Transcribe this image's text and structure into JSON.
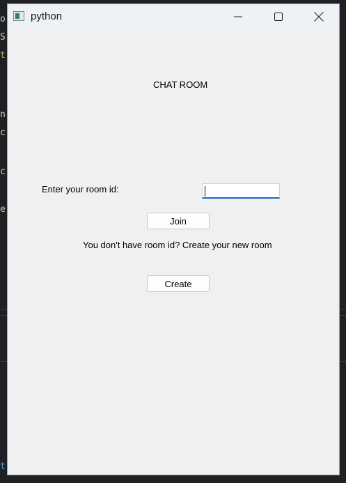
{
  "window": {
    "title": "python",
    "app_icon": "python-app-icon",
    "controls": {
      "minimize_icon": "minimize-icon",
      "maximize_icon": "maximize-icon",
      "close_icon": "close-icon"
    }
  },
  "main": {
    "heading": "CHAT ROOM",
    "room_label": "Enter your room id:",
    "room_input_value": "",
    "join_label": "Join",
    "hint_text": "You don't have room id? Create your new room",
    "create_label": "Create"
  },
  "colors": {
    "window_bg": "#f0f0f0",
    "titlebar_bg": "#eef2f7",
    "input_focus_accent": "#1e64c8",
    "backdrop_bg": "#1f2023"
  },
  "backdrop": {
    "fragments": [
      "o",
      "S",
      "t",
      "n",
      "c",
      "c",
      "e",
      "t"
    ]
  }
}
